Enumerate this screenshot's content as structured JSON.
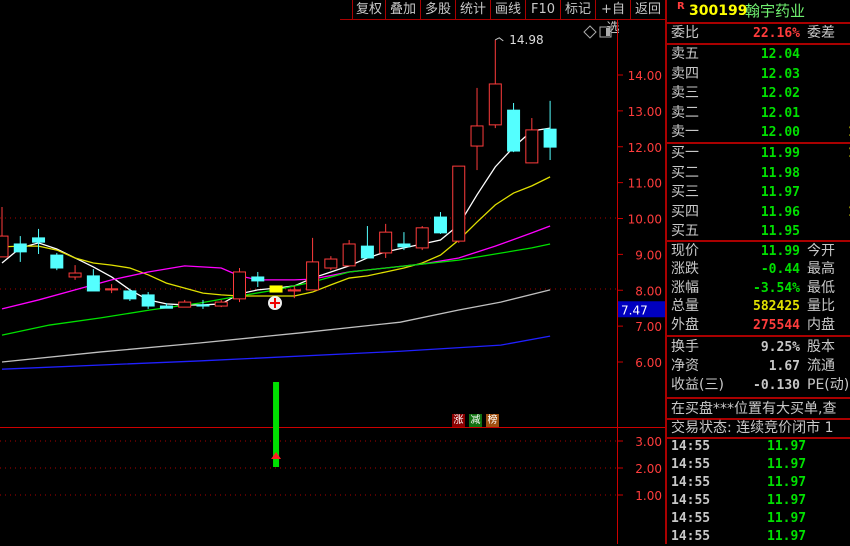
{
  "toolbar": [
    "复权",
    "叠加",
    "多股",
    "统计",
    "画线",
    "F10",
    "标记",
    "+自选",
    "返回"
  ],
  "stock": {
    "badge": "R",
    "code": "300199",
    "name": "翰宇药业"
  },
  "weibi": {
    "label": "委比",
    "value": "22.16%",
    "right": "委差"
  },
  "sell": [
    {
      "label": "卖五",
      "price": "12.04",
      "extra": ""
    },
    {
      "label": "卖四",
      "price": "12.03",
      "extra": ""
    },
    {
      "label": "卖三",
      "price": "12.02",
      "extra": ""
    },
    {
      "label": "卖二",
      "price": "12.01",
      "extra": ""
    },
    {
      "label": "卖一",
      "price": "12.00",
      "extra": "1"
    }
  ],
  "buy": [
    {
      "label": "买一",
      "price": "11.99",
      "extra": "1"
    },
    {
      "label": "买二",
      "price": "11.98",
      "extra": ""
    },
    {
      "label": "买三",
      "price": "11.97",
      "extra": ""
    },
    {
      "label": "买四",
      "price": "11.96",
      "extra": "1"
    },
    {
      "label": "买五",
      "price": "11.95",
      "extra": ""
    }
  ],
  "quote": [
    {
      "label": "现价",
      "value": "11.99",
      "color": "#00e000",
      "right": "今开"
    },
    {
      "label": "涨跌",
      "value": "-0.44",
      "color": "#00e000",
      "right": "最高"
    },
    {
      "label": "涨幅",
      "value": "-3.54%",
      "color": "#00e000",
      "right": "最低"
    },
    {
      "label": "总量",
      "value": "582425",
      "color": "#e0e000",
      "right": "量比"
    },
    {
      "label": "外盘",
      "value": "275544",
      "color": "#ff3c3c",
      "right": "内盘"
    }
  ],
  "fundamentals": [
    {
      "label": "换手",
      "value": "9.25%",
      "right": "股本"
    },
    {
      "label": "净资",
      "value": "1.67",
      "right": "流通"
    },
    {
      "label": "收益(三)",
      "value": "-0.130",
      "right": "PE(动)"
    }
  ],
  "message": "在买盘***位置有大买单,查",
  "trade_status": "交易状态: 连续竞价闭市 1",
  "ticks": [
    {
      "time": "14:55",
      "price": "11.97"
    },
    {
      "time": "14:55",
      "price": "11.97"
    },
    {
      "time": "14:55",
      "price": "11.97"
    },
    {
      "time": "14:55",
      "price": "11.97"
    },
    {
      "time": "14:55",
      "price": "11.97"
    },
    {
      "time": "14:55",
      "price": "11.97"
    }
  ],
  "badges": [
    {
      "text": "涨",
      "color": "#8b0000"
    },
    {
      "text": "减",
      "color": "#107010"
    },
    {
      "text": "榜",
      "color": "#a05010"
    }
  ],
  "chart_data": {
    "type": "candlestick",
    "price_axis": {
      "ticks": [
        "14.00",
        "13.00",
        "12.00",
        "11.00",
        "10.00",
        "9.00",
        "8.00",
        "7.00",
        "6.00"
      ],
      "ylim": [
        5.5,
        15.3
      ],
      "cursor_label": "7.47"
    },
    "max_label": "14.98",
    "candles": [
      [
        8.93,
        10.32,
        8.93,
        9.51
      ],
      [
        9.29,
        9.51,
        8.79,
        9.07
      ],
      [
        9.46,
        9.71,
        9.01,
        9.34
      ],
      [
        8.98,
        9.04,
        8.56,
        8.62
      ],
      [
        8.37,
        8.7,
        8.29,
        8.48
      ],
      [
        8.4,
        8.59,
        7.98,
        7.98
      ],
      [
        8.01,
        8.17,
        7.92,
        8.04
      ],
      [
        7.98,
        8.04,
        7.7,
        7.76
      ],
      [
        7.87,
        7.95,
        7.48,
        7.56
      ],
      [
        7.56,
        7.64,
        7.5,
        7.5
      ],
      [
        7.53,
        7.73,
        7.53,
        7.67
      ],
      [
        7.59,
        7.73,
        7.48,
        7.56
      ],
      [
        7.56,
        7.73,
        7.53,
        7.67
      ],
      [
        7.76,
        8.62,
        7.67,
        8.51
      ],
      [
        8.37,
        8.51,
        8.09,
        8.26
      ],
      [
        8.12,
        8.12,
        7.95,
        7.95
      ],
      [
        7.98,
        8.12,
        7.78,
        8.01
      ],
      [
        8.01,
        9.46,
        8.01,
        8.79
      ],
      [
        8.62,
        8.95,
        8.56,
        8.87
      ],
      [
        8.68,
        9.4,
        8.68,
        9.29
      ],
      [
        9.23,
        9.79,
        8.9,
        8.9
      ],
      [
        9.04,
        9.85,
        8.9,
        9.62
      ],
      [
        9.29,
        9.62,
        9.12,
        9.21
      ],
      [
        9.18,
        9.79,
        9.12,
        9.74
      ],
      [
        10.04,
        10.18,
        9.57,
        9.6
      ],
      [
        9.37,
        11.46,
        9.32,
        11.46
      ],
      [
        12.02,
        13.64,
        11.35,
        12.58
      ],
      [
        12.61,
        14.98,
        12.52,
        13.75
      ],
      [
        13.02,
        13.22,
        11.85,
        11.88
      ],
      [
        11.55,
        12.8,
        11.55,
        12.47
      ],
      [
        12.49,
        13.28,
        11.63,
        11.99
      ]
    ],
    "selected_index": 15,
    "ma": [
      {
        "name": "MA5",
        "color": "#ffffff",
        "points": [
          [
            0,
            8.76
          ],
          [
            1,
            9.18
          ],
          [
            2,
            9.32
          ],
          [
            3,
            9.15
          ],
          [
            4,
            8.9
          ],
          [
            5,
            8.65
          ],
          [
            6,
            8.37
          ],
          [
            7,
            8.01
          ],
          [
            8,
            7.73
          ],
          [
            9,
            7.62
          ],
          [
            10,
            7.59
          ],
          [
            11,
            7.59
          ],
          [
            12,
            7.62
          ],
          [
            13,
            7.9
          ],
          [
            14,
            8.01
          ],
          [
            15,
            8.06
          ],
          [
            16,
            8.12
          ],
          [
            17,
            8.34
          ],
          [
            18,
            8.51
          ],
          [
            19,
            8.68
          ],
          [
            20,
            8.9
          ],
          [
            21,
            9.07
          ],
          [
            22,
            9.18
          ],
          [
            23,
            9.29
          ],
          [
            24,
            9.4
          ],
          [
            25,
            9.82
          ],
          [
            26,
            10.66
          ],
          [
            27,
            11.44
          ],
          [
            28,
            11.99
          ],
          [
            29,
            12.44
          ],
          [
            30,
            12.52
          ]
        ]
      },
      {
        "name": "MA10",
        "color": "#e0e000",
        "points": [
          [
            0,
            9.21
          ],
          [
            1,
            9.23
          ],
          [
            2,
            9.23
          ],
          [
            3,
            9.12
          ],
          [
            4,
            8.9
          ],
          [
            5,
            8.76
          ],
          [
            6,
            8.7
          ],
          [
            7,
            8.62
          ],
          [
            8,
            8.43
          ],
          [
            9,
            8.2
          ],
          [
            10,
            8.06
          ],
          [
            11,
            7.92
          ],
          [
            12,
            7.87
          ],
          [
            13,
            7.84
          ],
          [
            14,
            7.84
          ],
          [
            15,
            7.84
          ],
          [
            16,
            7.84
          ],
          [
            17,
            7.95
          ],
          [
            18,
            8.15
          ],
          [
            19,
            8.34
          ],
          [
            20,
            8.4
          ],
          [
            21,
            8.51
          ],
          [
            22,
            8.62
          ],
          [
            23,
            8.76
          ],
          [
            24,
            8.98
          ],
          [
            25,
            9.4
          ],
          [
            26,
            9.9
          ],
          [
            27,
            10.38
          ],
          [
            28,
            10.71
          ],
          [
            29,
            10.91
          ],
          [
            30,
            11.16
          ]
        ]
      },
      {
        "name": "MA20",
        "color": "#ff00ff",
        "points": [
          [
            0,
            7.48
          ],
          [
            2,
            7.73
          ],
          [
            4,
            8.01
          ],
          [
            6,
            8.29
          ],
          [
            8,
            8.51
          ],
          [
            10,
            8.68
          ],
          [
            12,
            8.62
          ],
          [
            13,
            8.4
          ],
          [
            14,
            8.29
          ],
          [
            16,
            8.29
          ],
          [
            17,
            8.31
          ],
          [
            19,
            8.51
          ],
          [
            21,
            8.62
          ],
          [
            23,
            8.73
          ],
          [
            25,
            8.9
          ],
          [
            27,
            9.23
          ],
          [
            29,
            9.6
          ],
          [
            30,
            9.79
          ]
        ]
      },
      {
        "name": "MA60",
        "color": "#00e000",
        "points": [
          [
            0,
            6.75
          ],
          [
            2.6,
            7.03
          ],
          [
            5.4,
            7.23
          ],
          [
            8.1,
            7.45
          ],
          [
            10.8,
            7.64
          ],
          [
            13,
            7.84
          ],
          [
            15,
            8.01
          ],
          [
            17,
            8.23
          ],
          [
            19,
            8.51
          ],
          [
            21,
            8.62
          ],
          [
            23,
            8.73
          ],
          [
            25,
            8.84
          ],
          [
            27,
            9.01
          ],
          [
            29,
            9.18
          ],
          [
            30,
            9.29
          ]
        ]
      },
      {
        "name": "MA120",
        "color": "#c0c0c0",
        "points": [
          [
            0,
            6.0
          ],
          [
            5.4,
            6.28
          ],
          [
            10.8,
            6.53
          ],
          [
            16.3,
            6.81
          ],
          [
            21.8,
            7.11
          ],
          [
            25,
            7.45
          ],
          [
            27.3,
            7.67
          ],
          [
            30,
            8.01
          ]
        ]
      },
      {
        "name": "MA250",
        "color": "#2020ff",
        "points": [
          [
            0,
            5.8
          ],
          [
            10.8,
            6.03
          ],
          [
            21.8,
            6.3
          ],
          [
            27.3,
            6.47
          ],
          [
            30,
            6.72
          ]
        ]
      }
    ],
    "indicator": {
      "ticks": [
        "3.00",
        "2.00",
        "1.00"
      ],
      "ylim": [
        0,
        3.3
      ],
      "bars": [
        {
          "index": 15,
          "value": 3.0
        }
      ]
    }
  }
}
